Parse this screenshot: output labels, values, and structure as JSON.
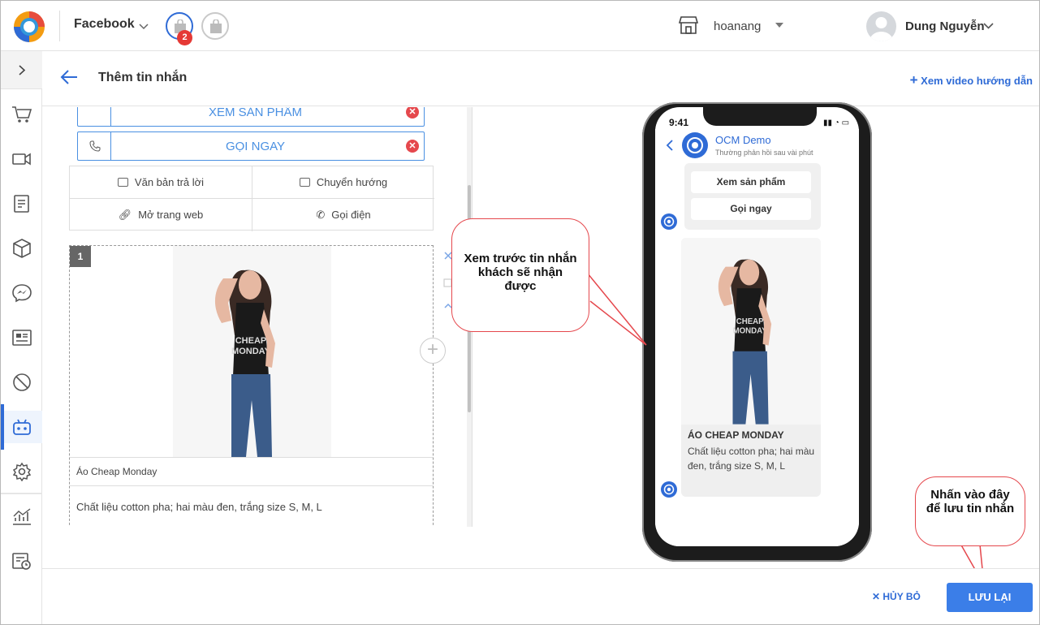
{
  "topbar": {
    "channel_label": "Facebook",
    "badge_count": "2",
    "shop_name": "hoanang",
    "user_name": "Dung Nguyễn"
  },
  "header": {
    "title": "Thêm tin nhắn",
    "guide_link": "Xem video hướng dẫn"
  },
  "editor": {
    "buttons": [
      {
        "label": "XEM SẢN PHẨM"
      },
      {
        "label": "GỌI NGAY"
      }
    ],
    "options": [
      {
        "label": "Văn bản trả lời",
        "icon": "message-icon"
      },
      {
        "label": "Chuyển hướng",
        "icon": "redirect-icon"
      },
      {
        "label": "Mở trang web",
        "icon": "link-icon"
      },
      {
        "label": "Gọi điện",
        "icon": "phone-icon"
      }
    ],
    "card": {
      "index": "1",
      "title": "Áo Cheap Monday",
      "subtitle": "Chất liệu cotton pha; hai màu đen, trắng size S, M, L",
      "shirt_text_1": "CHEAP",
      "shirt_text_2": "MONDAY"
    }
  },
  "preview": {
    "time": "9:41",
    "bot_name": "OCM Demo",
    "bot_status": "Thường phản hồi sau vài phút",
    "quick_buttons": [
      "Xem sản phẩm",
      "Gọi ngay"
    ],
    "card_title": "ÁO CHEAP MONDAY",
    "card_subtitle": "Chất liệu cotton pha; hai màu đen, trắng size S, M, L"
  },
  "callouts": {
    "preview_note": "Xem trước tin nhắn khách sẽ nhận được",
    "save_note": "Nhấn vào đây để lưu tin nhắn"
  },
  "footer": {
    "cancel_label": "HỦY BỎ",
    "save_label": "LƯU LẠI"
  },
  "colors": {
    "accent": "#2f6bd6",
    "save_button": "#3b7ee8",
    "delete": "#e5484d",
    "callout_border": "#e5484d"
  }
}
